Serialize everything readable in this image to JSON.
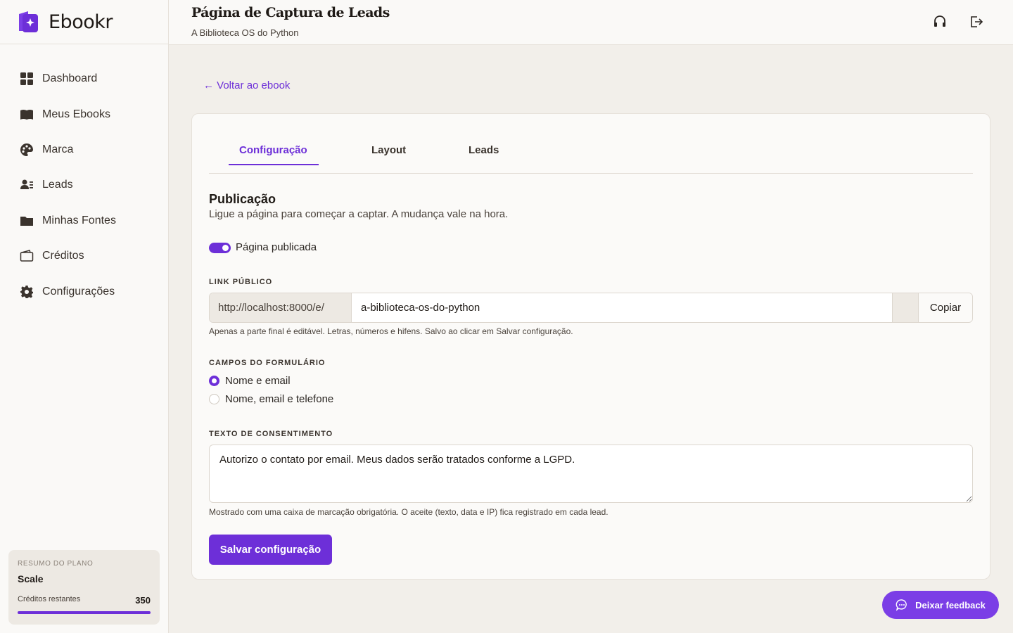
{
  "app": {
    "name": "Ebookr",
    "logo_icon": "ebookr-logo-icon"
  },
  "header": {
    "title": "Página de Captura de Leads",
    "subtitle": "A Biblioteca OS do Python",
    "icons": [
      "headset-icon",
      "logout-icon"
    ]
  },
  "sidebar": {
    "items": [
      {
        "label": "Dashboard",
        "icon": "grid-icon"
      },
      {
        "label": "Meus Ebooks",
        "icon": "book-icon"
      },
      {
        "label": "Marca",
        "icon": "palette-icon"
      },
      {
        "label": "Leads",
        "icon": "users-icon"
      },
      {
        "label": "Minhas Fontes",
        "icon": "folder-icon"
      },
      {
        "label": "Créditos",
        "icon": "wallet-icon"
      },
      {
        "label": "Configurações",
        "icon": "gear-icon"
      }
    ],
    "plan": {
      "label": "RESUMO DO PLANO",
      "name": "Scale",
      "credits_label": "Créditos restantes",
      "credits_value": "350"
    }
  },
  "main": {
    "back_link": "← Voltar ao ebook",
    "tabs": [
      {
        "label": "Configuração",
        "active": true
      },
      {
        "label": "Layout",
        "active": false
      },
      {
        "label": "Leads",
        "active": false
      }
    ],
    "publication": {
      "title": "Publicação",
      "description": "Ligue a página para começar a captar. A mudança vale na hora.",
      "toggle_label": "Página publicada",
      "toggle_on": true
    },
    "public_link": {
      "label": "LINK PÚBLICO",
      "prefix": "http://localhost:8000/e/",
      "slug": "a-biblioteca-os-do-python",
      "copy_label": "Copiar",
      "hint": "Apenas a parte final é editável. Letras, números e hifens. Salvo ao clicar em Salvar configuração."
    },
    "form_fields": {
      "label": "CAMPOS DO FORMULÁRIO",
      "options": [
        {
          "label": "Nome e email",
          "checked": true
        },
        {
          "label": "Nome, email e telefone",
          "checked": false
        }
      ]
    },
    "consent": {
      "label": "TEXTO DE CONSENTIMENTO",
      "value": "Autorizo o contato por email. Meus dados serão tratados conforme a LGPD.",
      "hint": "Mostrado com uma caixa de marcação obrigatória. O aceite (texto, data e IP) fica registrado em cada lead."
    },
    "save_label": "Salvar configuração"
  },
  "feedback": {
    "label": "Deixar feedback",
    "icon": "chat-icon"
  },
  "colors": {
    "accent": "#6d2fd8",
    "background": "#f2efea",
    "surface": "#fbfaf8"
  }
}
